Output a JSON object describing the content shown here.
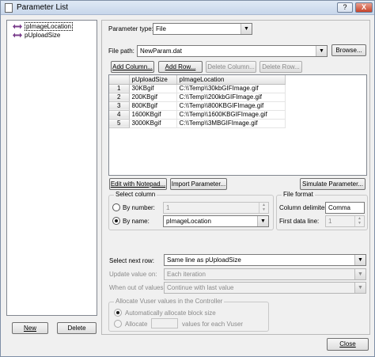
{
  "window": {
    "title": "Parameter List",
    "help_label": "?",
    "close_label": "X"
  },
  "tree": {
    "items": [
      {
        "label": "pImageLocation",
        "selected": true
      },
      {
        "label": "pUploadSize",
        "selected": false
      }
    ],
    "new_label": "New",
    "delete_label": "Delete"
  },
  "param": {
    "type_label": "Parameter type:",
    "type_value": "File",
    "file_path_label": "File path:",
    "file_path_value": "NewParam.dat",
    "browse_label": "Browse..."
  },
  "toolbar": {
    "add_column": "Add Column...",
    "add_row": "Add Row...",
    "delete_column": "Delete Column...",
    "delete_row": "Delete Row..."
  },
  "table": {
    "columns": [
      "pUploadSize",
      "pImageLocation"
    ],
    "rows": [
      {
        "num": "1",
        "cells": [
          "30KBgif",
          "C:\\\\Temp\\\\30kbGIFImage.gif"
        ]
      },
      {
        "num": "2",
        "cells": [
          "200KBgif",
          "C:\\\\Temp\\\\200kbGIFImage.gif"
        ]
      },
      {
        "num": "3",
        "cells": [
          "800KBgif",
          "C:\\\\Temp\\\\800KBGIFImage.gif"
        ]
      },
      {
        "num": "4",
        "cells": [
          "1600KBgif",
          "C:\\\\Temp\\\\1600KBGIFImage.gif"
        ]
      },
      {
        "num": "5",
        "cells": [
          "3000KBgif",
          "C:\\\\Temp\\\\3MBGIFImage.gif"
        ]
      }
    ]
  },
  "actions": {
    "edit_notepad": "Edit with Notepad...",
    "import_param": "Import Parameter...",
    "simulate_param": "Simulate Parameter..."
  },
  "select_column": {
    "title": "Select column",
    "by_number_label": "By number:",
    "by_number_value": "1",
    "by_name_label": "By name:",
    "by_name_value": "pImageLocation",
    "selected": "by_name"
  },
  "file_format": {
    "title": "File format",
    "delimiter_label": "Column delimiter:",
    "delimiter_value": "Comma",
    "first_line_label": "First data line:",
    "first_line_value": "1"
  },
  "row_options": {
    "select_next_label": "Select next row:",
    "select_next_value": "Same line as pUploadSize",
    "update_value_label": "Update value on:",
    "update_value_value": "Each iteration",
    "out_of_values_label": "When out of values:",
    "out_of_values_value": "Continue with last value"
  },
  "allocate": {
    "title": "Allocate Vuser values in the Controller",
    "auto_label": "Automatically allocate block size",
    "manual_label": "Allocate",
    "manual_suffix": "values for each Vuser",
    "manual_value": ""
  },
  "footer": {
    "close_label": "Close"
  },
  "colors": {
    "window_bg": "#f0f0f0",
    "icon_accent": "#7a3e8c"
  }
}
